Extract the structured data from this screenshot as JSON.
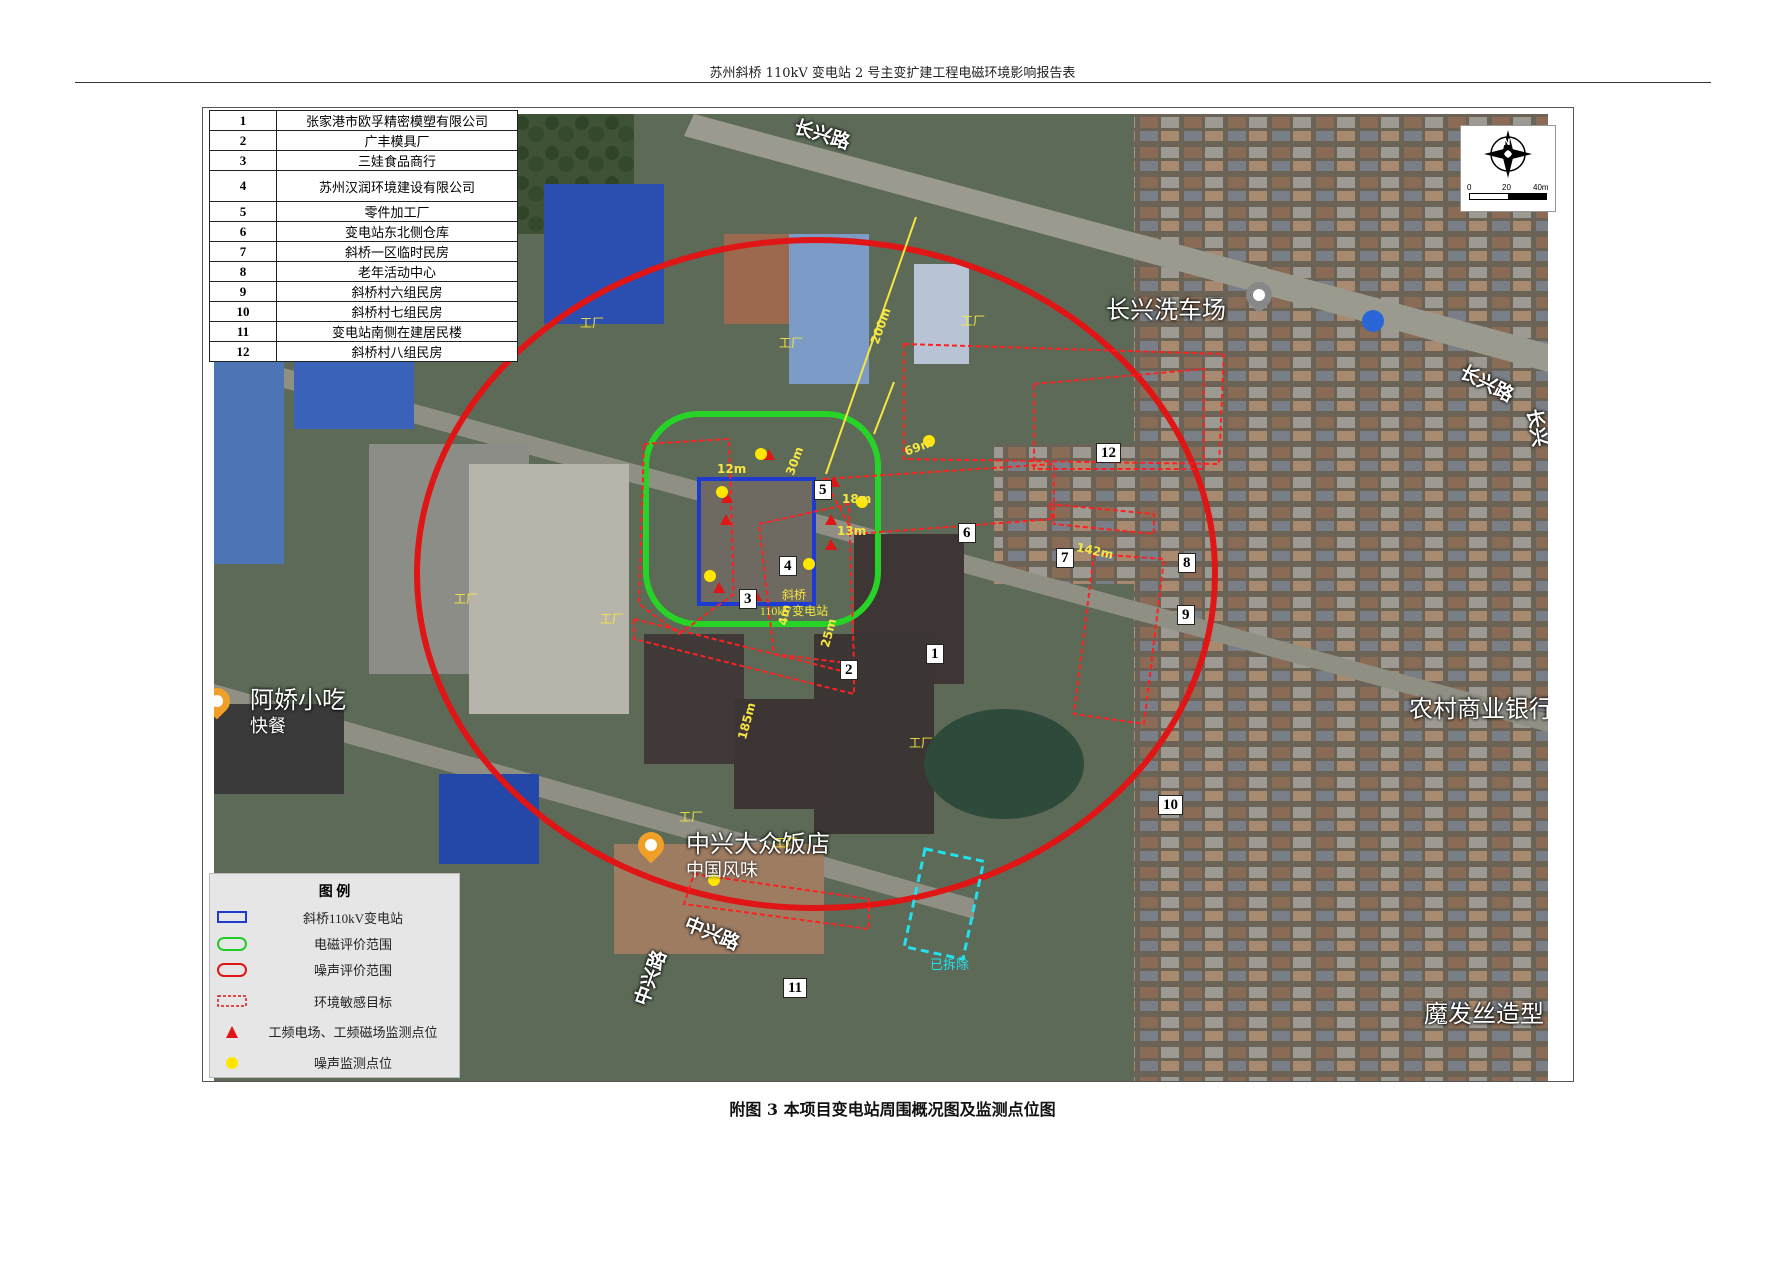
{
  "header": {
    "title": "苏州斜桥 110kV 变电站 2 号主变扩建工程电磁环境影响报告表"
  },
  "caption": "附图 3    本项目变电站周围概况图及监测点位图",
  "sensitive_targets": [
    {
      "no": "1",
      "name": "张家港市欧孚精密模塑有限公司"
    },
    {
      "no": "2",
      "name": "广丰模具厂"
    },
    {
      "no": "3",
      "name": "三娃食品商行"
    },
    {
      "no": "4",
      "name": "苏州汉润环境建设有限公司"
    },
    {
      "no": "5",
      "name": "零件加工厂"
    },
    {
      "no": "6",
      "name": "变电站东北侧仓库"
    },
    {
      "no": "7",
      "name": "斜桥一区临时民房"
    },
    {
      "no": "8",
      "name": "老年活动中心"
    },
    {
      "no": "9",
      "name": "斜桥村六组民房"
    },
    {
      "no": "10",
      "name": "斜桥村七组民房"
    },
    {
      "no": "11",
      "name": "变电站南侧在建居民楼"
    },
    {
      "no": "12",
      "name": "斜桥村八组民房"
    }
  ],
  "map": {
    "roads": [
      "长兴路",
      "长兴路",
      "中兴路",
      "中兴路",
      "长兴"
    ],
    "pois": [
      {
        "name": "长兴洗车场",
        "sub": ""
      },
      {
        "name": "阿娇小吃",
        "sub": "快餐"
      },
      {
        "name": "中兴大众饭店",
        "sub": "中国风味"
      },
      {
        "name": "农村商业银行",
        "sub": ""
      },
      {
        "name": "魔发丝造型",
        "sub": ""
      }
    ],
    "factory_label": "工厂",
    "substation_label_1": "斜桥",
    "substation_label_2": "110kV变电站",
    "demolished": "已拆除",
    "distances": {
      "d200": "200m",
      "d30": "30m",
      "d69": "69m",
      "d18": "18m",
      "d13": "13m",
      "d12": "12m",
      "d4": "4m",
      "d25": "25m",
      "d142": "142m",
      "d185": "185m"
    },
    "monitor_triangles": [
      "1",
      "2",
      "3",
      "4",
      "5",
      "6",
      "7",
      "8"
    ],
    "noise_points": [
      "1",
      "2",
      "3",
      "4",
      "5",
      "6",
      "7"
    ],
    "scale": {
      "zero": "0",
      "mid": "20",
      "end": "40m"
    },
    "north": "N"
  },
  "legend": {
    "title": "图  例",
    "items": [
      {
        "label": "斜桥110kV变电站",
        "color": "#1f3ad1"
      },
      {
        "label": "电磁评价范围",
        "color": "#22cc22"
      },
      {
        "label": "噪声评价范围",
        "color": "#e01515"
      },
      {
        "label": "环境敏感目标",
        "color": "#e01515"
      },
      {
        "label": "工频电场、工频磁场监测点位",
        "color": "#e01515"
      },
      {
        "label": "噪声监测点位",
        "color": "#ffe600"
      }
    ]
  }
}
